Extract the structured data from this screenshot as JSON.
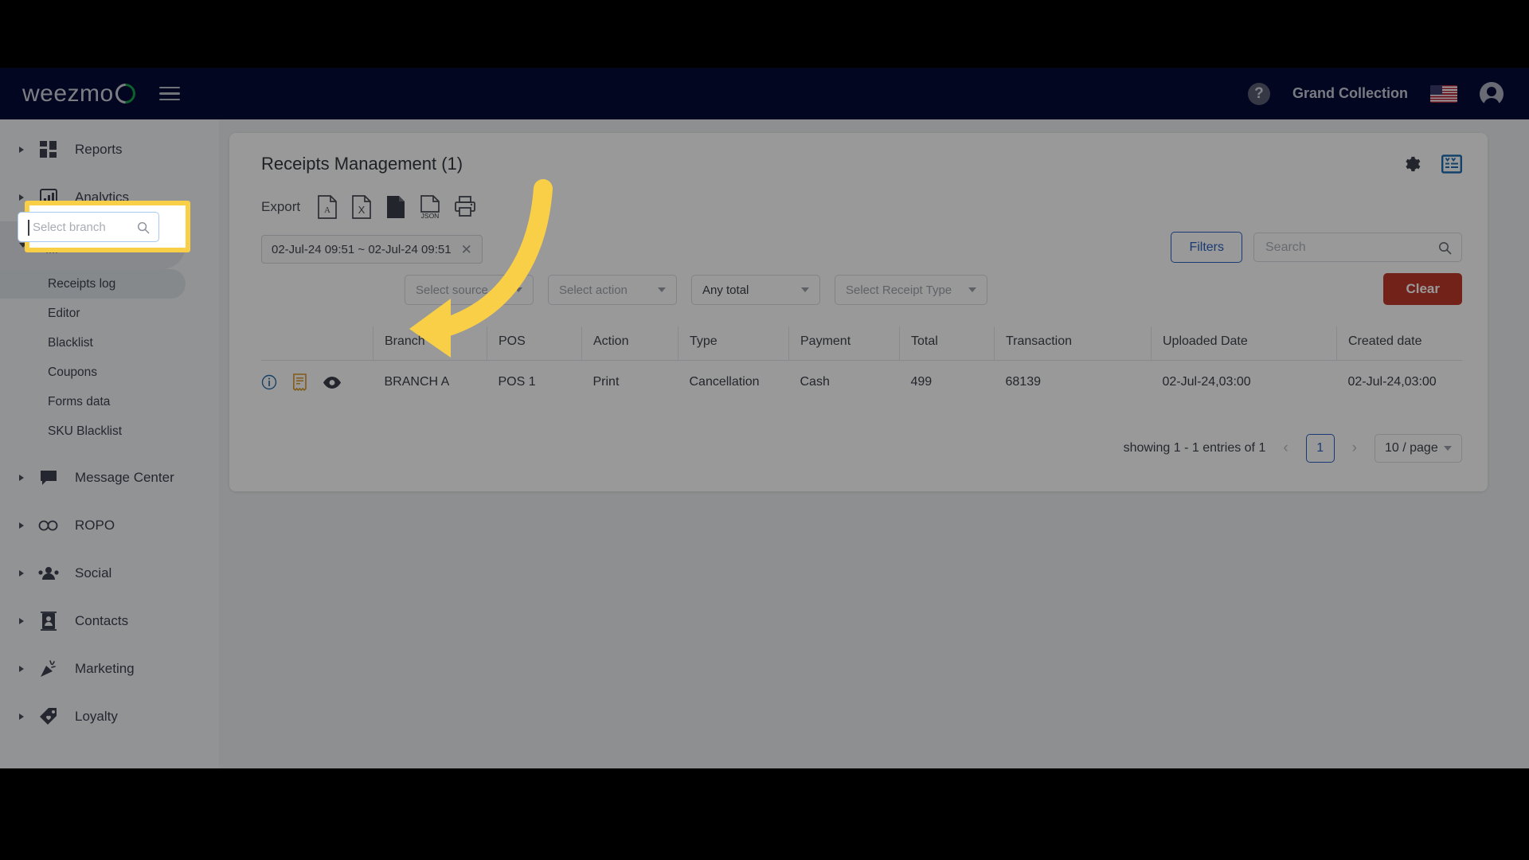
{
  "topbar": {
    "logo_text": "weezmo",
    "menu_icon": "hamburger-icon",
    "help_icon": "?",
    "account_name": "Grand Collection",
    "flag_icon": "us-flag-icon",
    "avatar_icon": "user-avatar-icon"
  },
  "sidebar": {
    "groups": [
      {
        "label": "Reports",
        "icon": "dashboard-icon",
        "expanded": false,
        "active": false
      },
      {
        "label": "Analytics",
        "icon": "bar-chart-icon",
        "expanded": false,
        "active": false
      },
      {
        "label": "Receipts",
        "icon": "receipt-icon",
        "expanded": true,
        "active": true
      },
      {
        "label": "Message Center",
        "icon": "chat-icon",
        "expanded": false,
        "active": false
      },
      {
        "label": "ROPO",
        "icon": "infinity-icon",
        "expanded": false,
        "active": false
      },
      {
        "label": "Social",
        "icon": "people-icon",
        "expanded": false,
        "active": false
      },
      {
        "label": "Contacts",
        "icon": "contact-card-icon",
        "expanded": false,
        "active": false
      },
      {
        "label": "Marketing",
        "icon": "megaphone-icon",
        "expanded": false,
        "active": false
      },
      {
        "label": "Loyalty",
        "icon": "tag-icon",
        "expanded": false,
        "active": false
      }
    ],
    "receipts_children": [
      {
        "label": "Receipts log",
        "active": true
      },
      {
        "label": "Editor",
        "active": false
      },
      {
        "label": "Blacklist",
        "active": false
      },
      {
        "label": "Coupons",
        "active": false
      },
      {
        "label": "Forms data",
        "active": false
      },
      {
        "label": "SKU Blacklist",
        "active": false
      }
    ]
  },
  "card": {
    "title": "Receipts Management (1)",
    "settings_icon": "gear-icon",
    "columns_icon": "table-columns-icon",
    "export": {
      "label": "Export",
      "items": [
        {
          "name": "export-pdf",
          "label": "PDF"
        },
        {
          "name": "export-excel",
          "label": "X"
        },
        {
          "name": "export-csv",
          "label": "CSV"
        },
        {
          "name": "export-json",
          "label": "JSON"
        },
        {
          "name": "export-print",
          "label": "Print"
        }
      ]
    },
    "date_range": "02-Jul-24 09:51 ~ 02-Jul-24 09:51",
    "filters": {
      "branch_placeholder": "Select branch",
      "source_placeholder": "Select source",
      "action_placeholder": "Select action",
      "total_value": "Any total",
      "receipt_type_placeholder": "Select Receipt Type",
      "filters_button": "Filters",
      "search_placeholder": "Search",
      "clear_button": "Clear"
    },
    "table": {
      "columns": [
        "",
        "Branch",
        "POS",
        "Action",
        "Type",
        "Payment",
        "Total",
        "Transaction",
        "Uploaded Date",
        "Created date"
      ],
      "rows": [
        {
          "icons": [
            "info-icon",
            "receipt-icon",
            "eye-icon"
          ],
          "branch": "BRANCH A",
          "pos": "POS 1",
          "action": "Print",
          "type": "Cancellation",
          "payment": "Cash",
          "total": "499",
          "transaction": "68139",
          "uploaded_date": "02-Jul-24,03:00",
          "created_date": "02-Jul-24,03:00"
        }
      ]
    },
    "pagination": {
      "summary": "showing 1 - 1 entries of 1",
      "prev": "‹",
      "page": "1",
      "next": "›",
      "page_size": "10 / page"
    }
  },
  "colors": {
    "topbar_bg": "#050a38",
    "accent_blue": "#2b63c4",
    "clear_red": "#c0392b",
    "highlight_yellow": "#f9cf47",
    "logo_green": "#16a34a"
  }
}
